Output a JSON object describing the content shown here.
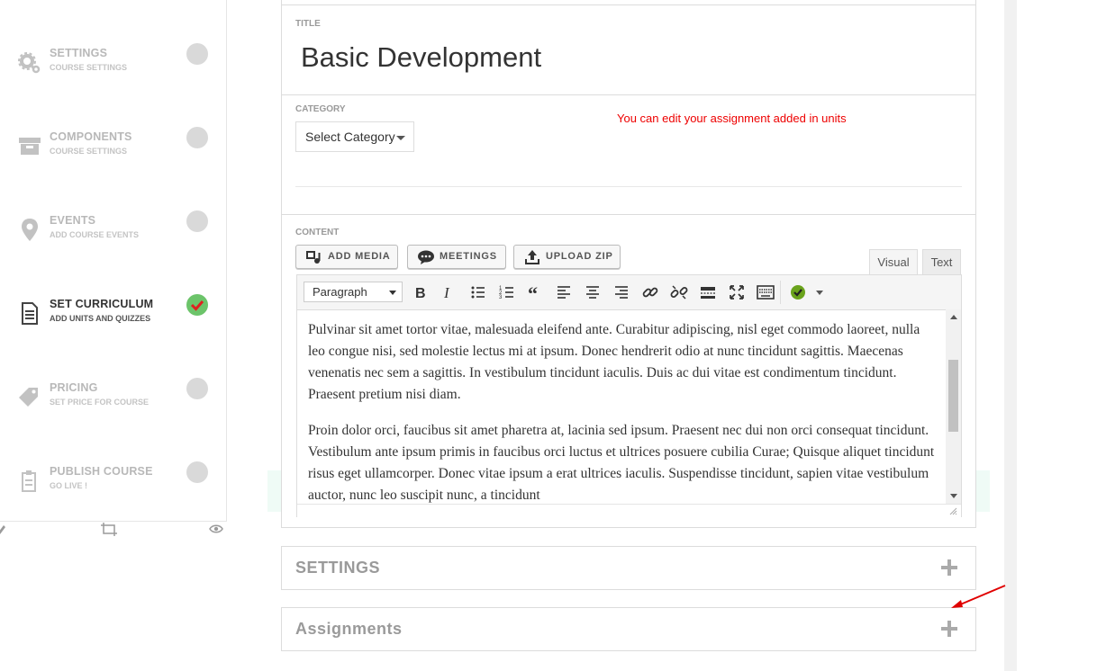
{
  "sidebar": {
    "steps": [
      {
        "title": "SETTINGS",
        "subtitle": "COURSE SETTINGS",
        "icon": "gears-icon",
        "done": false
      },
      {
        "title": "COMPONENTS",
        "subtitle": "COURSE SETTINGS",
        "icon": "archive-icon",
        "done": false
      },
      {
        "title": "EVENTS",
        "subtitle": "ADD COURSE EVENTS",
        "icon": "map-pin-icon",
        "done": false
      },
      {
        "title": "SET CURRICULUM",
        "subtitle": "ADD UNITS AND QUIZZES",
        "icon": "document-icon",
        "done": true
      },
      {
        "title": "PRICING",
        "subtitle": "SET PRICE FOR COURSE",
        "icon": "tag-icon",
        "done": false
      },
      {
        "title": "PUBLISH COURSE",
        "subtitle": "GO LIVE !",
        "icon": "clipboard-icon",
        "done": false
      }
    ],
    "tools": [
      "pencil-icon",
      "crop-icon",
      "eye-icon"
    ]
  },
  "title_section": {
    "label": "TITLE",
    "value": "Basic Development"
  },
  "category_section": {
    "label": "CATEGORY",
    "select_value": "Select Category",
    "note": "You can edit your assignment added in units"
  },
  "content_section": {
    "label": "CONTENT",
    "buttons": {
      "add_media": "ADD MEDIA",
      "meetings": "MEETINGS",
      "upload_zip": "UPLOAD ZIP"
    },
    "tabs": {
      "visual": "Visual",
      "text": "Text"
    },
    "format_select": "Paragraph",
    "paragraphs": [
      "Pulvinar sit amet tortor vitae, malesuada eleifend ante. Curabitur adipiscing, nisl eget commodo laoreet, nulla leo congue nisi, sed molestie lectus mi at ipsum. Donec hendrerit odio at nunc tincidunt sagittis. Maecenas venenatis nec sem a sagittis. In vestibulum tincidunt iaculis. Duis ac dui vitae est condimentum tincidunt. Praesent pretium nisi diam.",
      "Proin dolor orci, faucibus sit amet pharetra at, lacinia sed ipsum. Praesent nec dui non orci consequat tincidunt. Vestibulum ante ipsum primis in faucibus orci luctus et ultrices posuere cubilia Curae; Quisque aliquet tincidunt risus eget ullamcorper. Donec vitae ipsum a erat ultrices iaculis. Suspendisse tincidunt, sapien vitae vestibulum auctor, nunc leo suscipit nunc, a tincidunt"
    ]
  },
  "accordions": {
    "settings": "SETTINGS",
    "assignments": "Assignments"
  },
  "colors": {
    "note_red": "#ee0000",
    "check_green": "#6cc46a",
    "arrow_red": "#e00000"
  }
}
